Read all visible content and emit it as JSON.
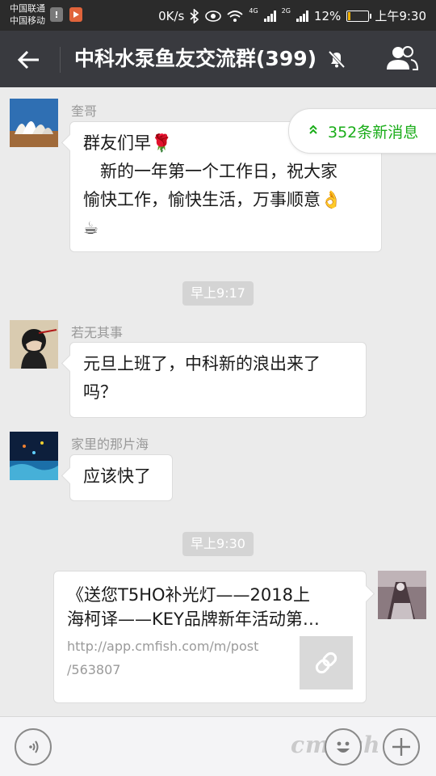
{
  "status_bar": {
    "carrier_1": "中国联通",
    "carrier_2": "中国移动",
    "speed": "0K/s",
    "battery_percent": "12%",
    "battery_level": 0.12,
    "time": "上午9:30",
    "net_1": "4G",
    "net_2": "2G",
    "icons": [
      "warning-icon",
      "video-icon",
      "bluetooth-icon",
      "eye-icon",
      "wifi-icon",
      "signal-icon",
      "battery-icon"
    ]
  },
  "header": {
    "title": "中科水泵鱼友交流群(399)",
    "icons": [
      "back-arrow-icon",
      "mute-icon",
      "group-members-icon"
    ]
  },
  "new_messages": {
    "label": "352条新消息",
    "color": "#1aad19"
  },
  "messages": [
    {
      "sender": "奎哥",
      "lines": [
        "群友们早🌹",
        "　新的一年第一个工作日，祝大家",
        "愉快工作，愉快生活，万事顺意👌",
        "☕"
      ]
    },
    {
      "timestamp": "早上9:17"
    },
    {
      "sender": "若无其事",
      "lines": [
        "元旦上班了，中科新的浪出来了",
        "吗？"
      ]
    },
    {
      "sender": "家里的那片海",
      "lines": [
        "应该快了"
      ]
    },
    {
      "timestamp": "早上9:30"
    },
    {
      "link_card": {
        "title_lines": [
          "《送您T5HO补光灯——2018上",
          "海柯译——KEY品牌新年活动第…"
        ],
        "url_lines": [
          "http://app.cmfish.com/m/post",
          "/563807"
        ]
      }
    }
  ],
  "input_bar": {
    "icons": [
      "voice-icon",
      "emoji-icon",
      "plus-icon"
    ],
    "watermark": "cmfish"
  },
  "colors": {
    "titlebar": "#393a3f",
    "background": "#ebebeb",
    "accent": "#1aad19"
  }
}
